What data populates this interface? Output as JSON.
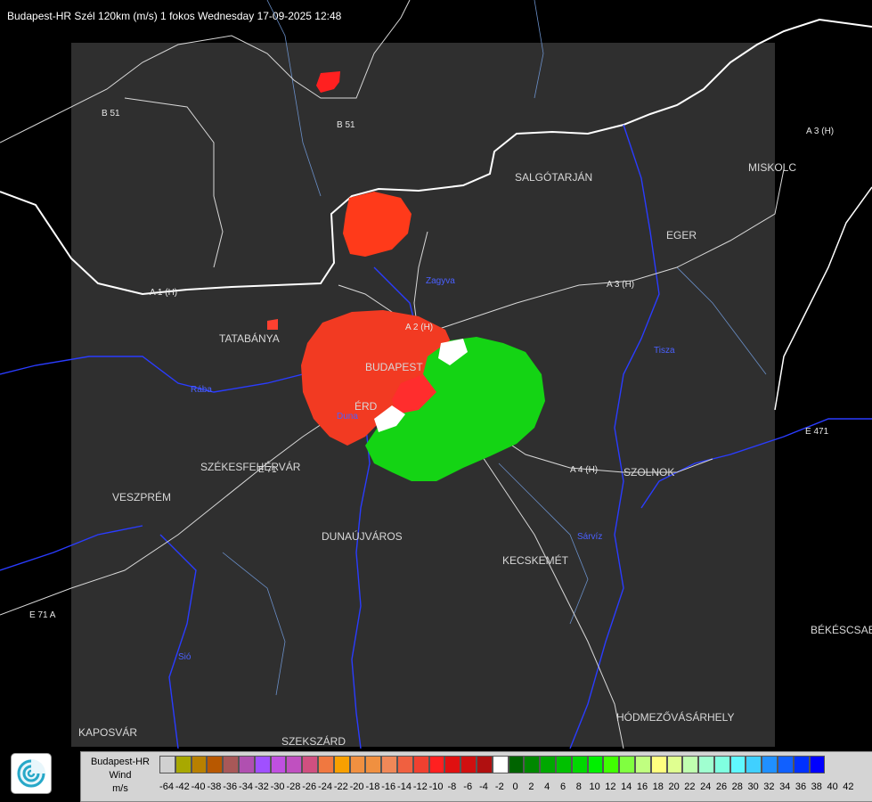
{
  "header": {
    "title": "Budapest-HR Szél 120km (m/s) 1 fokos Wednesday 17-09-2025 12:48"
  },
  "map": {
    "cities": [
      "SALGÓTARJÁN",
      "MISKOLC",
      "EGER",
      "TATABÁNYA",
      "BUDAPEST",
      "ÉRD",
      "SZÉKESFEHÉRVÁR",
      "VESZPRÉM",
      "DUNAÚJVÁROS",
      "SZOLNOK",
      "KECSKEMÉT",
      "BÉKÉSCSABA",
      "HÓDMEZŐVÁSÁRHELY",
      "KAPOSVÁR",
      "SZEKSZÁRD"
    ],
    "roads": [
      "B 51",
      "B 51",
      "A 3 (H)",
      "A 3 (H)",
      "A 1 (H)",
      "A 2 (H)",
      "A 4 (H)",
      "E 71",
      "E 71 A",
      "E 471"
    ],
    "rivers": [
      "Tisza",
      "Duna",
      "Sió",
      "Zagyva",
      "Rába",
      "Sárvíz"
    ]
  },
  "legend": {
    "title_lines": [
      "Budapest-HR",
      "Wind",
      "m/s"
    ],
    "colors": [
      "#d0d0d0",
      "#a8a800",
      "#b88000",
      "#b85800",
      "#a85858",
      "#b050b0",
      "#a050ff",
      "#c050e0",
      "#c050c0",
      "#d05080",
      "#f07840",
      "#f8a000",
      "#f09040",
      "#f09040",
      "#f08858",
      "#f06040",
      "#f04030",
      "#ff2020",
      "#e01010",
      "#d01010",
      "#b01010",
      "#ffffff",
      "#006400",
      "#008800",
      "#00a800",
      "#00c000",
      "#00d800",
      "#00f000",
      "#40ff00",
      "#80ff40",
      "#c0ff80",
      "#ffff80",
      "#e0ff90",
      "#c0ffb0",
      "#a0ffd0",
      "#80ffe0",
      "#60f8ff",
      "#40d0ff",
      "#2090ff",
      "#1060ff",
      "#0030ff",
      "#0000ff"
    ],
    "ticks": [
      "-64",
      "-42",
      "-40",
      "-38",
      "-36",
      "-34",
      "-32",
      "-30",
      "-28",
      "-26",
      "-24",
      "-22",
      "-20",
      "-18",
      "-16",
      "-14",
      "-12",
      "-10",
      "-8",
      "-6",
      "-4",
      "-2",
      "0",
      "2",
      "4",
      "6",
      "8",
      "10",
      "12",
      "14",
      "16",
      "18",
      "20",
      "22",
      "24",
      "26",
      "28",
      "30",
      "32",
      "34",
      "36",
      "38",
      "40",
      "42"
    ]
  }
}
